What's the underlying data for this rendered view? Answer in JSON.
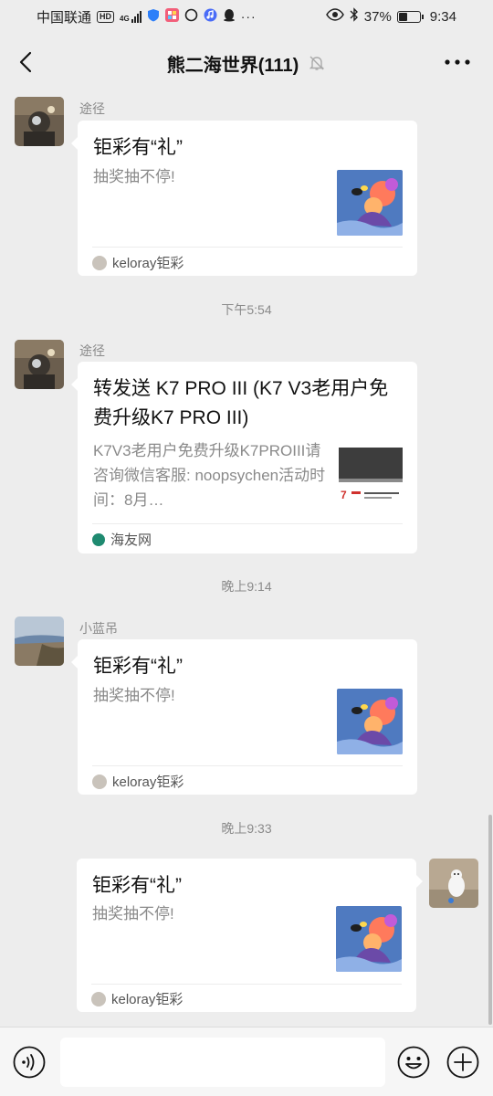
{
  "status_bar": {
    "carrier": "中国联通",
    "hd": "HD",
    "signal": "4G",
    "battery": "37%",
    "battery_level": 0.37,
    "time": "9:34"
  },
  "header": {
    "title": "熊二海世界(111)"
  },
  "messages": [
    {
      "sender": "途径",
      "card_title": "钜彩有“礼”",
      "card_desc": "抽奖抽不停!",
      "source": "keloray钜彩"
    },
    {
      "timestamp": "下午5:54",
      "sender": "途径",
      "card_title": "转发送 K7 PRO III (K7 V3老用户免费升级K7 PRO III)",
      "card_desc": "K7V3老用户免费升级K7PROIII请咨询微信客服: noopsychen活动时间：8月…",
      "source": "海友网"
    },
    {
      "timestamp": "晚上9:14",
      "sender": "小蓝吊",
      "card_title": "钜彩有“礼”",
      "card_desc": "抽奖抽不停!",
      "source": "keloray钜彩"
    },
    {
      "timestamp": "晚上9:33",
      "card_title": "钜彩有“礼”",
      "card_desc": "抽奖抽不停!",
      "source": "keloray钜彩"
    }
  ],
  "input": {
    "value": ""
  },
  "colors": {
    "background": "#ededed",
    "card": "#ffffff",
    "muted_text": "#8a8a8a",
    "input_bar": "#f6f6f6"
  }
}
